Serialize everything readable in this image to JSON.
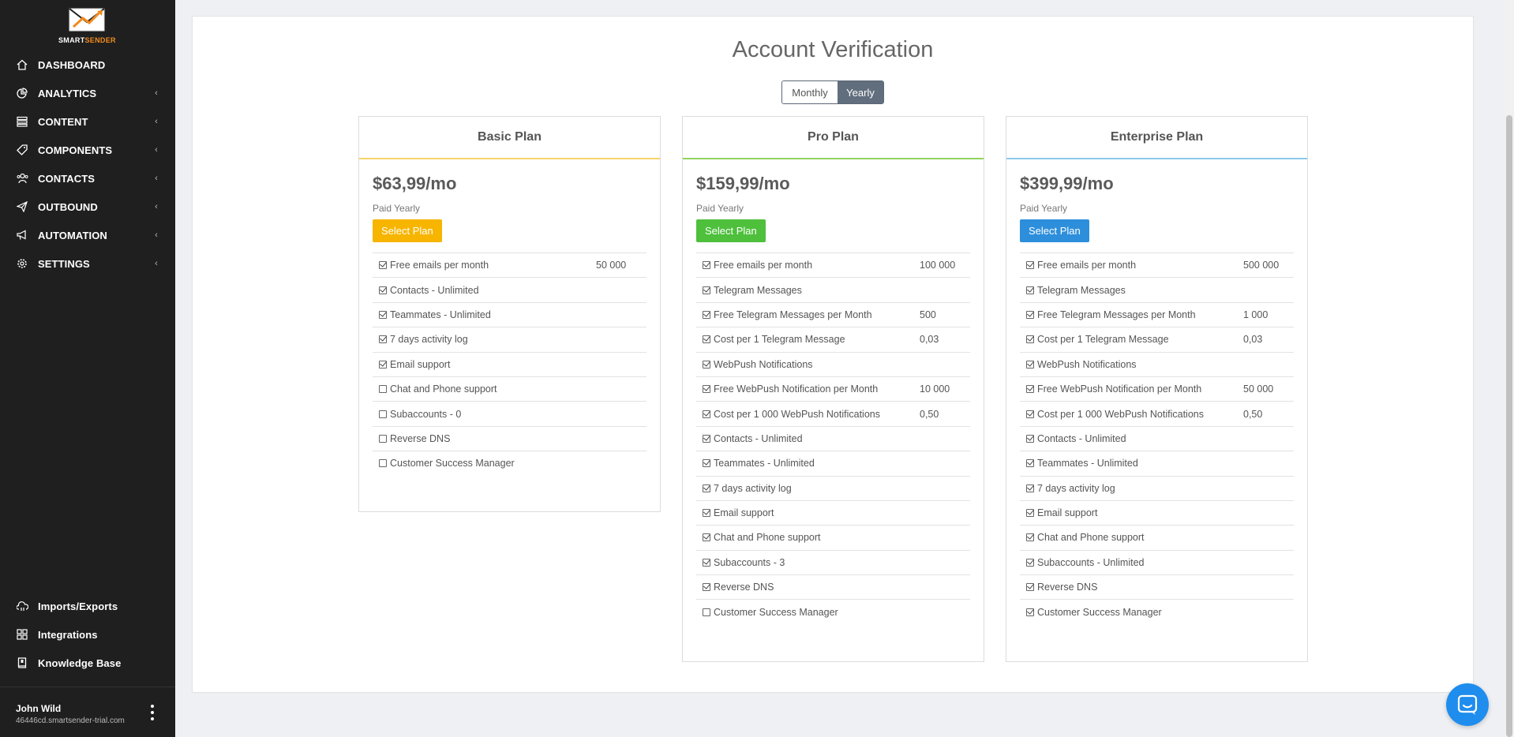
{
  "app": {
    "brand_main": "SMART",
    "brand_accent": "SENDER"
  },
  "sidebar": {
    "items": [
      {
        "label": "DASHBOARD",
        "icon": "home-icon",
        "has_submenu": false
      },
      {
        "label": "ANALYTICS",
        "icon": "pie-chart-icon",
        "has_submenu": true
      },
      {
        "label": "CONTENT",
        "icon": "list-icon",
        "has_submenu": true
      },
      {
        "label": "COMPONENTS",
        "icon": "tag-icon",
        "has_submenu": true
      },
      {
        "label": "CONTACTS",
        "icon": "users-icon",
        "has_submenu": true
      },
      {
        "label": "OUTBOUND",
        "icon": "paper-plane-icon",
        "has_submenu": true
      },
      {
        "label": "AUTOMATION",
        "icon": "megaphone-icon",
        "has_submenu": true
      },
      {
        "label": "SETTINGS",
        "icon": "gear-icon",
        "has_submenu": true
      }
    ],
    "chevron": "‹",
    "bottom_items": [
      {
        "label": "Imports/Exports",
        "icon": "cloud-transfer-icon"
      },
      {
        "label": "Integrations",
        "icon": "grid-icon"
      },
      {
        "label": "Knowledge Base",
        "icon": "book-icon"
      }
    ],
    "user": {
      "name": "John Wild",
      "account": "46446cd.smartsender-trial.com"
    }
  },
  "page": {
    "title": "Account Verification",
    "toggle": {
      "monthly": "Monthly",
      "yearly": "Yearly",
      "selected": "yearly"
    }
  },
  "plans": [
    {
      "name": "Basic Plan",
      "price": "$63,99/mo",
      "billing": "Paid Yearly",
      "button": "Select Plan",
      "accent_color": "#f7d46a",
      "button_color": "#f7b500",
      "features": [
        {
          "label": "Free emails per month",
          "value": "50 000",
          "checked": true
        },
        {
          "label": "Contacts - Unlimited",
          "value": "",
          "checked": true
        },
        {
          "label": "Teammates - Unlimited",
          "value": "",
          "checked": true
        },
        {
          "label": "7 days activity log",
          "value": "",
          "checked": true
        },
        {
          "label": "Email support",
          "value": "",
          "checked": true
        },
        {
          "label": "Chat and Phone support",
          "value": "",
          "checked": false
        },
        {
          "label": "Subaccounts - 0",
          "value": "",
          "checked": false
        },
        {
          "label": "Reverse DNS",
          "value": "",
          "checked": false
        },
        {
          "label": "Customer Success Manager",
          "value": "",
          "checked": false
        }
      ]
    },
    {
      "name": "Pro Plan",
      "price": "$159,99/mo",
      "billing": "Paid Yearly",
      "button": "Select Plan",
      "accent_color": "#8fd35f",
      "button_color": "#4ec03c",
      "features": [
        {
          "label": "Free emails per month",
          "value": "100 000",
          "checked": true
        },
        {
          "label": "Telegram Messages",
          "value": "",
          "checked": true
        },
        {
          "label": "Free Telegram Messages per Month",
          "value": "500",
          "checked": true
        },
        {
          "label": "Cost per 1 Telegram Message",
          "value": "0,03",
          "checked": true
        },
        {
          "label": "WebPush Notifications",
          "value": "",
          "checked": true
        },
        {
          "label": "Free WebPush Notification per Month",
          "value": "10 000",
          "checked": true
        },
        {
          "label": "Cost per 1 000 WebPush Notifications",
          "value": "0,50",
          "checked": true
        },
        {
          "label": "Contacts - Unlimited",
          "value": "",
          "checked": true
        },
        {
          "label": "Teammates - Unlimited",
          "value": "",
          "checked": true
        },
        {
          "label": "7 days activity log",
          "value": "",
          "checked": true
        },
        {
          "label": "Email support",
          "value": "",
          "checked": true
        },
        {
          "label": "Chat and Phone support",
          "value": "",
          "checked": true
        },
        {
          "label": "Subaccounts - 3",
          "value": "",
          "checked": true
        },
        {
          "label": "Reverse DNS",
          "value": "",
          "checked": true
        },
        {
          "label": "Customer Success Manager",
          "value": "",
          "checked": false
        }
      ]
    },
    {
      "name": "Enterprise Plan",
      "price": "$399,99/mo",
      "billing": "Paid Yearly",
      "button": "Select Plan",
      "accent_color": "#8cc8ec",
      "button_color": "#2d8fdb",
      "features": [
        {
          "label": "Free emails per month",
          "value": "500 000",
          "checked": true
        },
        {
          "label": "Telegram Messages",
          "value": "",
          "checked": true
        },
        {
          "label": "Free Telegram Messages per Month",
          "value": "1 000",
          "checked": true
        },
        {
          "label": "Cost per 1 Telegram Message",
          "value": "0,03",
          "checked": true
        },
        {
          "label": "WebPush Notifications",
          "value": "",
          "checked": true
        },
        {
          "label": "Free WebPush Notification per Month",
          "value": "50 000",
          "checked": true
        },
        {
          "label": "Cost per 1 000 WebPush Notifications",
          "value": "0,50",
          "checked": true
        },
        {
          "label": "Contacts - Unlimited",
          "value": "",
          "checked": true
        },
        {
          "label": "Teammates - Unlimited",
          "value": "",
          "checked": true
        },
        {
          "label": "7 days activity log",
          "value": "",
          "checked": true
        },
        {
          "label": "Email support",
          "value": "",
          "checked": true
        },
        {
          "label": "Chat and Phone support",
          "value": "",
          "checked": true
        },
        {
          "label": "Subaccounts - Unlimited",
          "value": "",
          "checked": true
        },
        {
          "label": "Reverse DNS",
          "value": "",
          "checked": true
        },
        {
          "label": "Customer Success Manager",
          "value": "",
          "checked": true
        }
      ]
    }
  ],
  "chat_widget": {
    "icon": "chat-bubble-icon",
    "color": "#1f8ded"
  }
}
